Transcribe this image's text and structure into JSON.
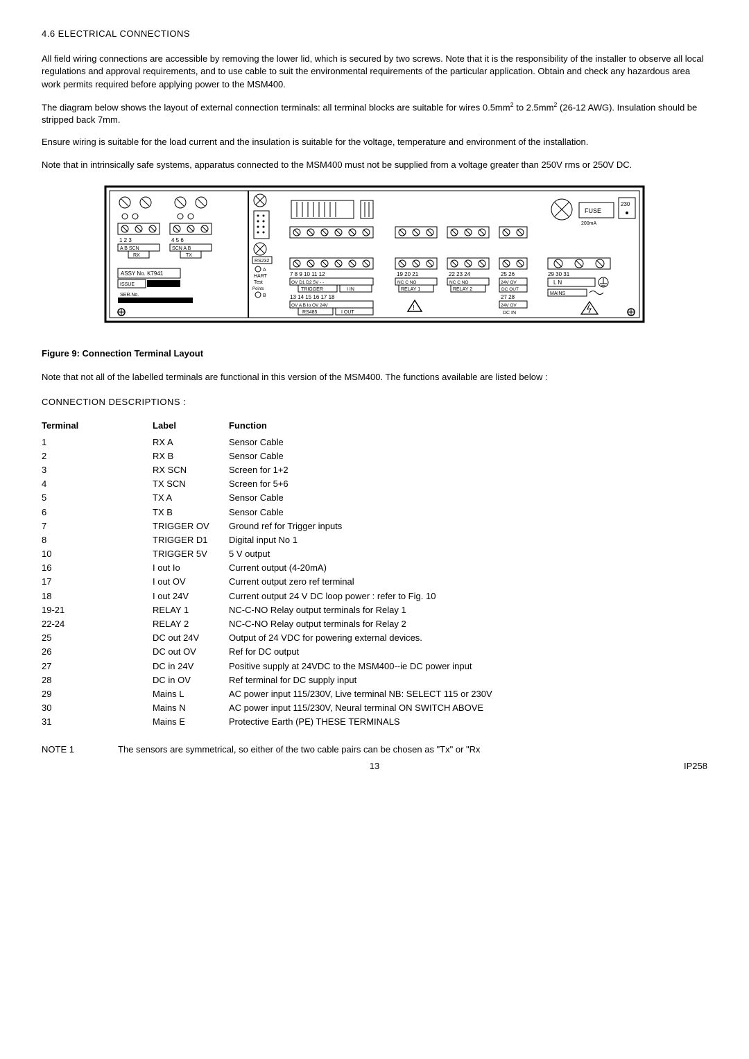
{
  "heading": "4.6    ELECTRICAL CONNECTIONS",
  "para1": "All field wiring connections are accessible by removing the lower lid, which is secured  by two screws. Note that it is the responsibility of the installer to observe all local regulations and approval requirements, and to use cable to suit the environmental requirements of the particular application.  Obtain and check any hazardous area work permits required before applying power to the MSM400.",
  "para2a": "The diagram below shows the layout of external connection terminals: all terminal blocks are suitable for wires 0.5mm",
  "para2b": " to 2.5mm",
  "para2c": " (26-12 AWG). Insulation should be stripped back 7mm.",
  "para3": "Ensure wiring is suitable for the load current and the insulation is suitable for the voltage, temperature and environment of the installation.",
  "para4": "Note that in intrinsically safe systems, apparatus connected to the MSM400 must not be supplied from a voltage greater than 250V rms or 250V DC.",
  "figureCaption": "Figure 9:    Connection Terminal Layout",
  "afterFigure": "Note that not all of the labelled terminals are functional in this version of the MSM400. The functions available are listed below :",
  "connDescTitle": "CONNECTION DESCRIPTIONS :",
  "tableHeaders": {
    "terminal": "Terminal",
    "label": "Label",
    "function": "Function"
  },
  "rows": [
    {
      "terminal": "1",
      "label": "RX  A",
      "function": "Sensor Cable"
    },
    {
      "terminal": "2",
      "label": "RX   B",
      "function": "Sensor Cable"
    },
    {
      "terminal": "3",
      "label": "RX  SCN",
      "function": "Screen for 1+2"
    },
    {
      "terminal": "4",
      "label": "TX  SCN",
      "function": "Screen for 5+6"
    },
    {
      "terminal": "5",
      "label": "TX   A",
      "function": "Sensor Cable"
    },
    {
      "terminal": "6",
      "label": "TX   B",
      "function": "Sensor Cable"
    },
    {
      "terminal": "7",
      "label": "TRIGGER OV",
      "function": "Ground ref for Trigger inputs"
    },
    {
      "terminal": "8",
      "label": "TRIGGER D1",
      "function": "Digital input No 1"
    },
    {
      "terminal": "10",
      "label": "TRIGGER 5V",
      "function": "5 V output"
    },
    {
      "terminal": "16",
      "label": "I out Io",
      "function": "Current output (4-20mA)"
    },
    {
      "terminal": "17",
      "label": "I out OV",
      "function": "Current output zero ref terminal"
    },
    {
      "terminal": "18",
      "label": "I out  24V",
      "function": "Current output 24 V DC loop power  :  refer to Fig. 10"
    },
    {
      "terminal": "19-21",
      "label": "RELAY 1",
      "function": "NC-C-NO Relay output  terminals for Relay 1"
    },
    {
      "terminal": "22-24",
      "label": "RELAY 2",
      "function": "NC-C-NO Relay output  terminals for Relay 2"
    },
    {
      "terminal": "25",
      "label": "DC out 24V",
      "function": "Output of 24 VDC for powering external devices."
    },
    {
      "terminal": "26",
      "label": "DC out OV",
      "function": "Ref for DC output"
    },
    {
      "terminal": "27",
      "label": "DC in 24V",
      "function": "Positive supply at 24VDC to the MSM400--ie DC power input"
    },
    {
      "terminal": "28",
      "label": "DC in OV",
      "function": "Ref terminal for DC supply input"
    },
    {
      "terminal": "29",
      "label": "Mains L",
      "function": "AC power input 115/230V, Live terminal          NB: SELECT 115 or 230V"
    },
    {
      "terminal": "30",
      "label": "Mains N",
      "function": "AC power input 115/230V, Neural terminal               ON SWITCH ABOVE"
    },
    {
      "terminal": "31",
      "label": "Mains E",
      "function": "Protective Earth (PE)                                                 THESE TERMINALS"
    }
  ],
  "note1Label": "NOTE 1",
  "note1Text": "The sensors are symmetrical, so either of the two cable pairs can be chosen as \"Tx\" or \"Rx",
  "pageNumber": "13",
  "ipCode": "IP258",
  "diagram": {
    "rx": "RX",
    "tx": "TX",
    "assy": "ASSY No. K7941",
    "issue": "ISSUE",
    "ser": "SER.No.",
    "scn": "SCN",
    "rs232": "RS232",
    "hart": "HART",
    "test": "Test",
    "points": "Points",
    "trigger": "TRIGGER",
    "iin": "I IN",
    "rs485": "RS485",
    "iout": "I OUT",
    "relay1": "RELAY 1",
    "relay2": "RELAY 2",
    "dcout": "DC OUT",
    "dcin": "DC IN",
    "mains": "MAINS",
    "fuse": "FUSE",
    "ma200": "200mA",
    "v230": "230",
    "nos1": "1    2    3",
    "nos4": "4    5    6",
    "n7_12": "7    8    9    10  11  12",
    "n13_18": "13  14  15  16  17  18",
    "n19_21": "19 20  21",
    "n22_24": "22  23  24",
    "n25_26": "25  26",
    "n27_28": "27  28",
    "n29_31": "29      30      31",
    "row1a": "A   B  SCN",
    "row1b": "SCN  A   B",
    "row7": "OV  D1  D2  5V   -    -",
    "row13": "OV  A   B   Io  OV  24V",
    "row19": "NC   C   NO",
    "row22": "NC  C   NO",
    "row25": "24V  OV",
    "row27": "24V  OV",
    "lnE": "L      N"
  }
}
